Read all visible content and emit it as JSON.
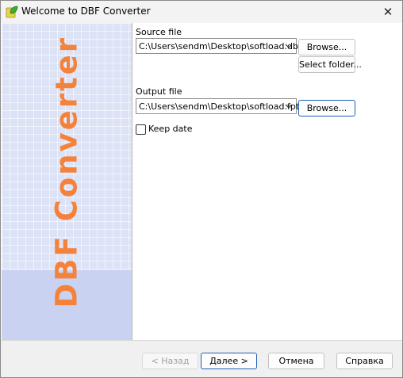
{
  "window": {
    "title": "Welcome to DBF Converter",
    "close_glyph": "✕"
  },
  "sidebar": {
    "brand_text": "DBF Converter",
    "brand_color": "#f5823a",
    "background": "#dde3f7"
  },
  "form": {
    "source_label": "Source file",
    "source_value": "C:\\Users\\sendm\\Desktop\\softload.db",
    "browse_label": "Browse...",
    "select_folder_label": "Select folder...",
    "output_label": "Output file",
    "output_value": "C:\\Users\\sendm\\Desktop\\softload.fpt",
    "output_browse_label": "Browse...",
    "keep_date_label": "Keep date",
    "keep_date_checked": false
  },
  "footer": {
    "back_label": "< Назад",
    "next_label": "Далее >",
    "cancel_label": "Отмена",
    "help_label": "Справка"
  },
  "icons": {
    "app": "app-leaf-icon",
    "dropdown": "chevron-down-icon",
    "close": "close-icon"
  }
}
